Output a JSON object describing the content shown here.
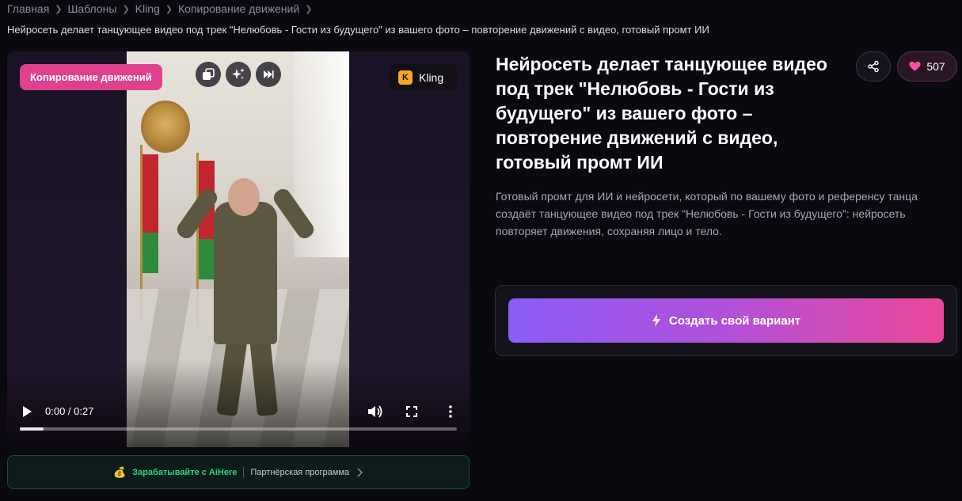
{
  "breadcrumb": [
    "Главная",
    "Шаблоны",
    "Kling",
    "Копирование движений"
  ],
  "page_subtitle": "Нейросеть делает танцующее видео под трек \"Нелюбовь - Гости из будущего\" из вашего фото – повторение движений с видео, готовый промт ИИ",
  "video": {
    "template_badge": "Копирование движений",
    "model_badge": "Kling",
    "model_logo_letter": "K",
    "time": "0:00 / 0:27",
    "progress": 0.055,
    "icons": [
      "copy-icon",
      "sparkles-icon",
      "skip-forward-icon",
      "play-icon",
      "volume-icon",
      "fullscreen-icon",
      "more-vertical-icon"
    ]
  },
  "affiliate": {
    "earn_label": "Зарабатывайте с AiHere",
    "partner_label": "Партнёрская программа"
  },
  "detail": {
    "title_lines": [
      "Нейросеть делает танцующее видео",
      "под трек \"Нелюбовь - Гости из",
      "будущего\" из вашего фото –",
      "повторение движений с видео,",
      "готовый промт ИИ"
    ],
    "likes": "507",
    "description": "Готовый промт для ИИ и нейросети, который по вашему фото и референсу танца создаёт танцующее видео под трек \"Нелюбовь - Гости из будущего\": нейросеть повторяет движения, сохраняя лицо и тело.",
    "cta_label": "Создать свой вариант"
  },
  "colors": {
    "accent_pink": "#e0418e",
    "cta_start": "#8b5cf6",
    "cta_end": "#ec4899",
    "earn_green": "#2fd47a"
  }
}
